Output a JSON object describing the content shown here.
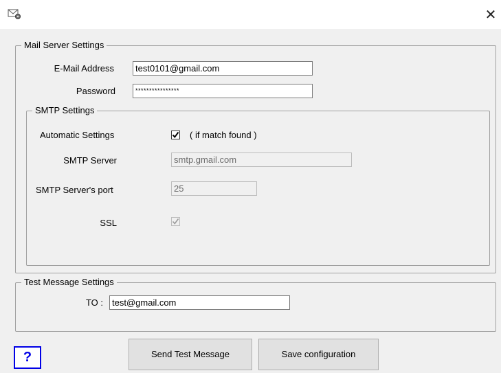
{
  "window": {
    "icon": "mail-settings-icon",
    "close_glyph": "✕"
  },
  "mail_server": {
    "legend": "Mail Server Settings",
    "email_label": "E-Mail Address",
    "email_value": "test0101@gmail.com",
    "password_label": "Password",
    "password_value": "****************"
  },
  "smtp": {
    "legend": "SMTP Settings",
    "auto_label": "Automatic Settings",
    "auto_checked": true,
    "auto_note": "( if match found )",
    "server_label": "SMTP Server",
    "server_value": "smtp.gmail.com",
    "port_label": "SMTP Server's port",
    "port_value": "25",
    "ssl_label": "SSL",
    "ssl_checked": true
  },
  "test_message": {
    "legend": "Test Message Settings",
    "to_label": "TO :",
    "to_value": "test@gmail.com"
  },
  "buttons": {
    "help": "?",
    "send": "Send Test Message",
    "save": "Save configuration"
  },
  "colors": {
    "help_accent": "#0000e6",
    "background": "#f0f0f0"
  }
}
